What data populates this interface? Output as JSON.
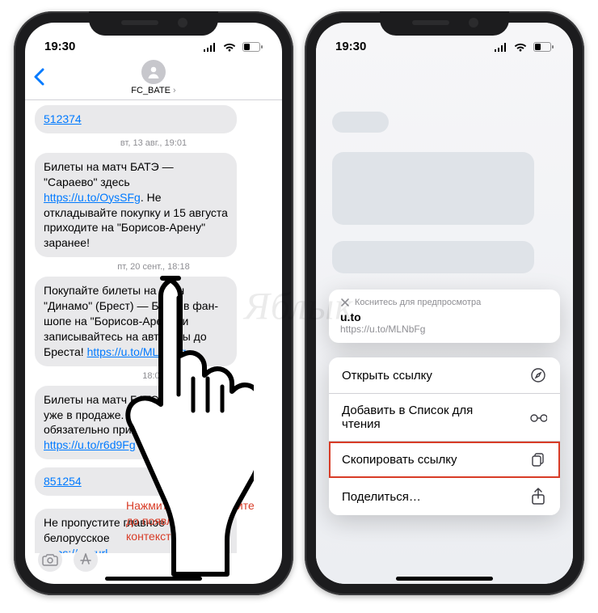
{
  "watermark": "Яблык",
  "status": {
    "time": "19:30"
  },
  "nav": {
    "contact": "FC_BATE"
  },
  "messages": {
    "link_top": "512374",
    "ts1": "вт, 13 авг., 19:01",
    "m1_a": "Билеты на матч БАТЭ — \"Сараево\" здесь ",
    "m1_link": "https://u.to/OysSFg",
    "m1_b": ". Не откладывайте покупку и 15 августа приходите на \"Борисов-Арену\" заранее!",
    "ts2": "пт, 20 сент., 18:18",
    "m2_a": "Покупайте билеты на матч \"Динамо\" (Брест) — БАТЭ в фан-шопе на \"Борисов-Арене\" и записывайтесь на автобусы до Бреста! ",
    "m2_link": "https://u.to/MLNbFg",
    "ts3": "18:01",
    "m3_a": "Билеты на матч БАТЭ — \"Гомель\" уже в продаже. Зовите друзей и обязательно приходите! ",
    "m3_link": "https://u.to/r6d9Fg",
    "link_mid": "851254",
    "m4_a": "Не пропустите главное белорусское ",
    "m4_link": "https://tinyurl."
  },
  "callout": "Нажмите и удерживайте до появления контекстного меню",
  "preview": {
    "hint": "Коснитесь для предпросмотра",
    "title": "u.to",
    "url": "https://u.to/MLNbFg"
  },
  "menu": {
    "open": "Открыть ссылку",
    "readlist": "Добавить в Список для чтения",
    "copy": "Скопировать ссылку",
    "share": "Поделиться…"
  },
  "icons": {
    "back": "chevron-left",
    "person": "person",
    "camera": "camera",
    "apps": "appstore",
    "signal": "cellular",
    "wifi": "wifi",
    "battery": "battery",
    "safari": "compass",
    "glasses": "reading-list",
    "copy": "doc-on-doc",
    "share": "square-arrow-up",
    "close": "xmark"
  }
}
